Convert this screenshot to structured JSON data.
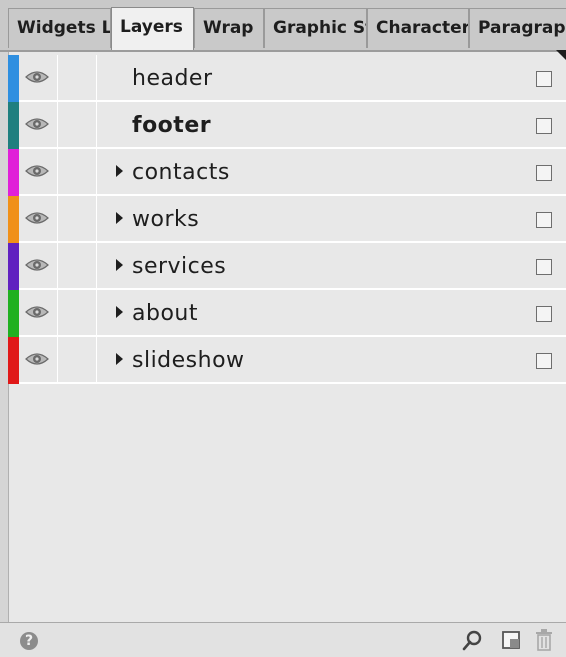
{
  "tabs": [
    {
      "label": "Widgets Library",
      "active": false
    },
    {
      "label": "Layers",
      "active": true
    },
    {
      "label": "Wrap",
      "active": false
    },
    {
      "label": "Graphic Styles",
      "active": false
    },
    {
      "label": "Character",
      "active": false
    },
    {
      "label": "Paragraph",
      "active": false
    }
  ],
  "layers": [
    {
      "name": "header",
      "color": "#2f8fe0",
      "expandable": false,
      "bold": false,
      "visible": true,
      "locked": false
    },
    {
      "name": "footer",
      "color": "#1f7f7f",
      "expandable": false,
      "bold": true,
      "visible": true,
      "locked": false
    },
    {
      "name": "contacts",
      "color": "#e020d8",
      "expandable": true,
      "bold": false,
      "visible": true,
      "locked": false
    },
    {
      "name": "works",
      "color": "#f09018",
      "expandable": true,
      "bold": false,
      "visible": true,
      "locked": false
    },
    {
      "name": "services",
      "color": "#6020c0",
      "expandable": true,
      "bold": false,
      "visible": true,
      "locked": false
    },
    {
      "name": "about",
      "color": "#20b020",
      "expandable": true,
      "bold": false,
      "visible": true,
      "locked": false
    },
    {
      "name": "slideshow",
      "color": "#e01818",
      "expandable": true,
      "bold": false,
      "visible": true,
      "locked": false
    }
  ],
  "footer": {
    "help_glyph": "?",
    "icons": [
      "help-icon",
      "search-icon",
      "new-layer-icon",
      "trash-icon"
    ]
  }
}
